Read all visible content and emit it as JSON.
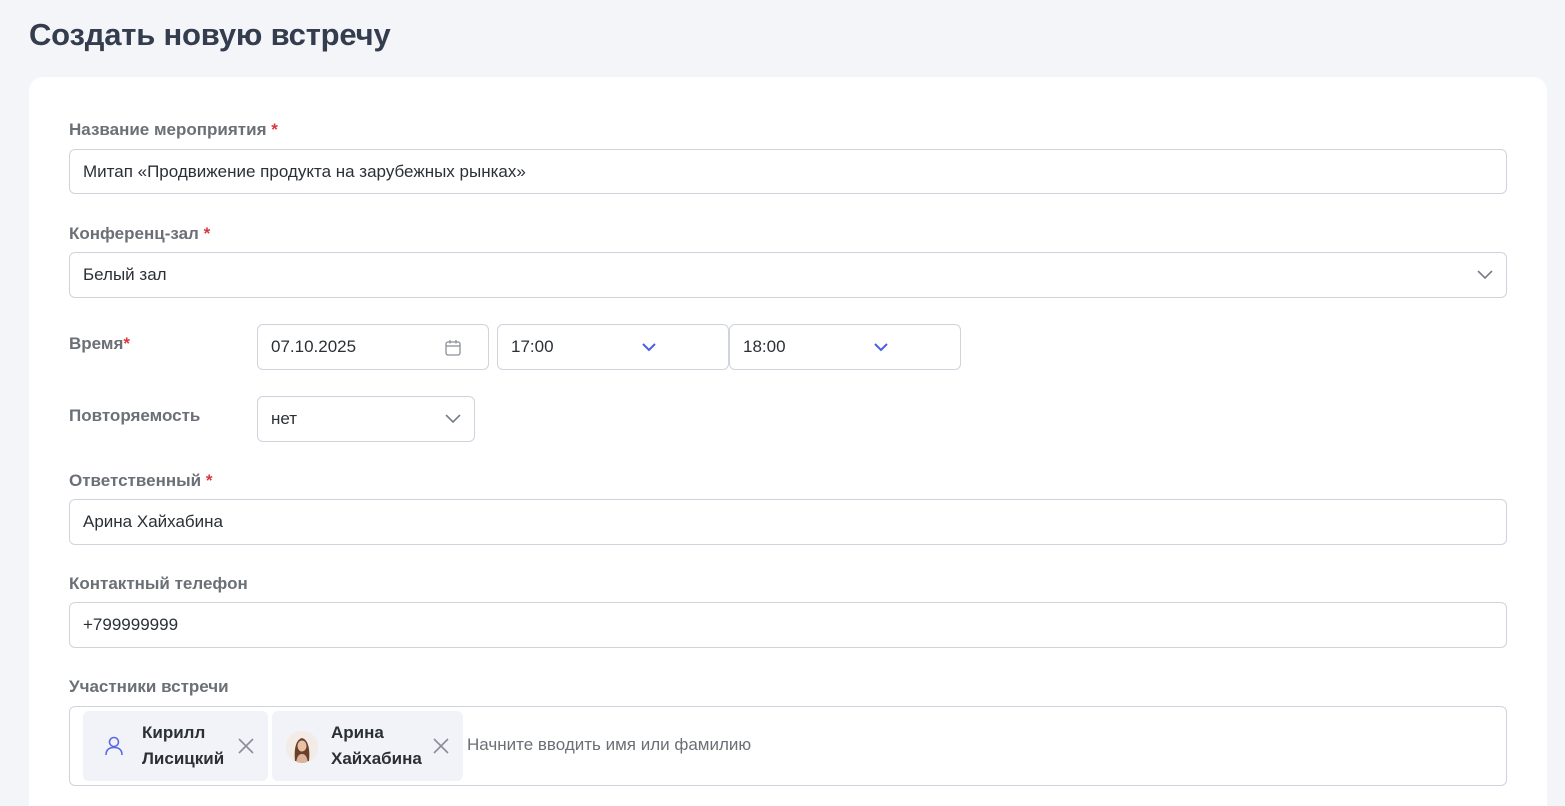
{
  "page": {
    "title": "Создать новую встречу"
  },
  "form": {
    "event_name": {
      "label": "Название мероприятия",
      "required_mark": "*",
      "value": "Митап «Продвижение продукта на зарубежных рынках»"
    },
    "room": {
      "label": "Конференц-зал",
      "required_mark": "*",
      "value": "Белый зал"
    },
    "time": {
      "label": "Время",
      "required_mark": "*",
      "date": "07.10.2025",
      "start": "17:00",
      "end": "18:00"
    },
    "recurrence": {
      "label": "Повторяемость",
      "value": "нет"
    },
    "responsible": {
      "label": "Ответственный",
      "required_mark": "*",
      "value": "Арина Хайхабина"
    },
    "phone": {
      "label": "Контактный телефон",
      "value": "+799999999"
    },
    "participants": {
      "label": "Участники встречи",
      "placeholder": "Начните вводить имя или фамилию",
      "chips": [
        {
          "first": "Кирилл",
          "last": "Лисицкий",
          "avatar": "user-icon"
        },
        {
          "first": "Арина",
          "last": "Хайхабина",
          "avatar": "photo-avatar"
        }
      ]
    }
  },
  "colors": {
    "accent": "#4a5ee8",
    "required": "#d9363e",
    "chip_bg": "#f1f3f8",
    "page_bg": "#f3f5f9"
  }
}
